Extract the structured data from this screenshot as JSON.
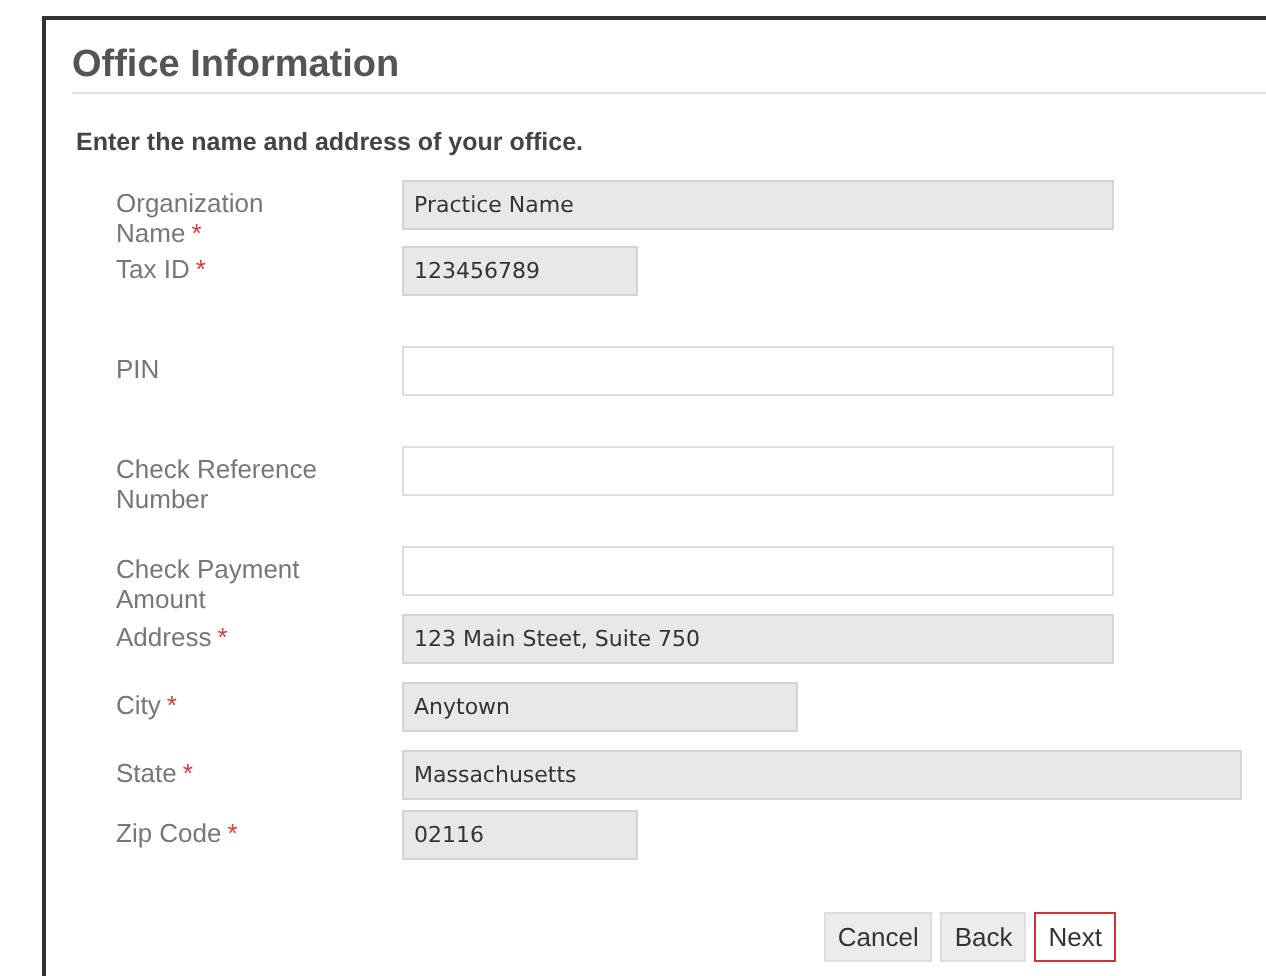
{
  "section": {
    "title": "Office Information",
    "instruction": "Enter the name and address of your office."
  },
  "fields": [
    {
      "label": "Organization Name",
      "required_mark": "*",
      "value": "Practice Name",
      "readonly": true
    },
    {
      "label": "Tax ID",
      "required_mark": "*",
      "value": "123456789",
      "readonly": true
    },
    {
      "label": "PIN",
      "readonly": false
    },
    {
      "label": "Check Reference Number",
      "readonly": false
    },
    {
      "label": "Check Payment Amount",
      "readonly": false
    },
    {
      "label": "Address",
      "required_mark": "*",
      "value": "123 Main Steet, Suite 750",
      "readonly": true
    },
    {
      "label": "City",
      "required_mark": "*",
      "value": "Anytown",
      "readonly": true
    },
    {
      "label": "State",
      "required_mark": "*",
      "value": "Massachusetts",
      "readonly": true
    },
    {
      "label": "Zip Code",
      "required_mark": "*",
      "value": "02116",
      "readonly": true
    }
  ],
  "buttons": [
    {
      "label": "Cancel",
      "focused": false
    },
    {
      "label": "Back",
      "focused": false
    },
    {
      "label": "Next",
      "focused": true
    }
  ]
}
